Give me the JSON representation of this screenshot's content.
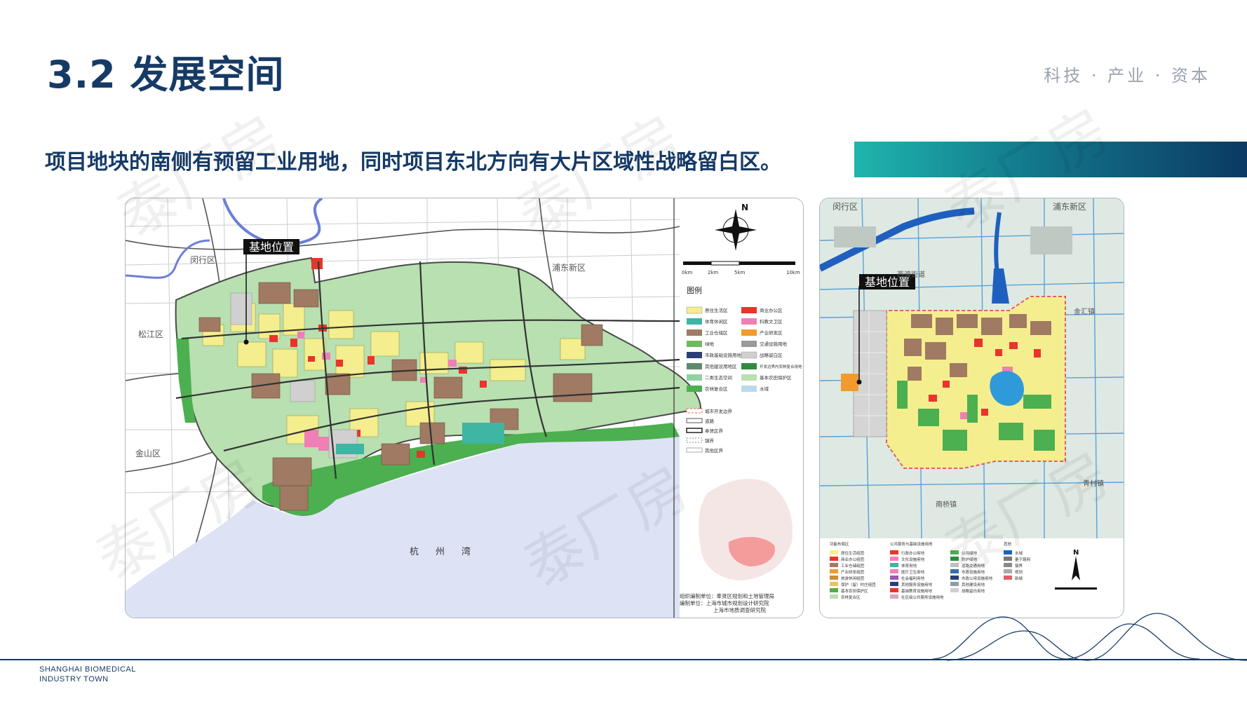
{
  "header": {
    "title": "3.2 发展空间",
    "tagline": "科技 · 产业 · 资本"
  },
  "subtitle": "项目地块的南侧有预留工业用地，同时项目东北方向有大片区域性战略留白区。",
  "watermark": "泰厂房",
  "map_left": {
    "marker": "基地位置",
    "districts": [
      "闵行区",
      "浦东新区",
      "松江区",
      "金山区"
    ],
    "bay": "杭州湾",
    "scale_labels": [
      "0km",
      "2km",
      "5km",
      "10km"
    ],
    "north": "N",
    "legend_title": "图例",
    "legend_left": [
      "居住生活区",
      "体育休闲区",
      "工业仓储区",
      "绿地",
      "市政基础设施用地",
      "其他建设用地区",
      "二类生态空间",
      "农林复合区"
    ],
    "legend_right": [
      "商业办公区",
      "科教文卫区",
      "产业研发区",
      "交通设施用地",
      "战略留白区",
      "开发边界内农林复合用地",
      "基本农田保护区",
      "水域"
    ],
    "legend_lines": [
      "城市开发边界",
      "道路",
      "奉贤区界",
      "镇界",
      "其他区界"
    ],
    "credit_1": "组织编制单位：奉贤区规划和土地管理局",
    "credit_2": "编制单位：上海市城市规划设计研究院",
    "credit_3": "上海市地质调查研究院"
  },
  "map_right": {
    "marker": "基地位置",
    "districts": [
      "闵行区",
      "浦东新区",
      "金汇镇",
      "西渡街道",
      "南桥镇",
      "青村镇"
    ],
    "north": "N",
    "legend_cols": [
      {
        "header": "功能布局区",
        "items": [
          "居住生活组团",
          "商业办公组团",
          "工业仓储组团",
          "产业研发组团",
          "旅游休闲组团",
          "保护（留）村庄组团",
          "基本农田保护区",
          "农林复合区"
        ]
      },
      {
        "header": "公共服务与基础设施用地",
        "items": [
          "行政办公用地",
          "文化设施用地",
          "体育用地",
          "医疗卫生用地",
          "社会福利用地",
          "其他服务设施用地",
          "基础教育设施用地",
          "社区级公共服务设施用地"
        ]
      },
      {
        "header": "",
        "items": [
          "公共绿地",
          "防护绿地",
          "道路交通用地",
          "市政设施用地",
          "市政公用设施用地",
          "其他建设用地",
          "战略留白用地"
        ]
      },
      {
        "header": "其他",
        "items": [
          "水域",
          "量于路网",
          "镇界",
          "规划",
          "新城"
        ]
      }
    ]
  },
  "footer": {
    "line1": "SHANGHAI BIOMEDICAL",
    "line2": "INDUSTRY TOWN"
  },
  "colors": {
    "navy": "#163a66",
    "teal": "#1fb5ad",
    "land_green": "#b8e0b0",
    "residential": "#f5ee8e",
    "industrial": "#a07a62",
    "commercial": "#e8352b",
    "pink": "#f07fb5",
    "dark_green": "#4caf50",
    "water": "#dde3f5",
    "river": "#1f5fbf"
  }
}
